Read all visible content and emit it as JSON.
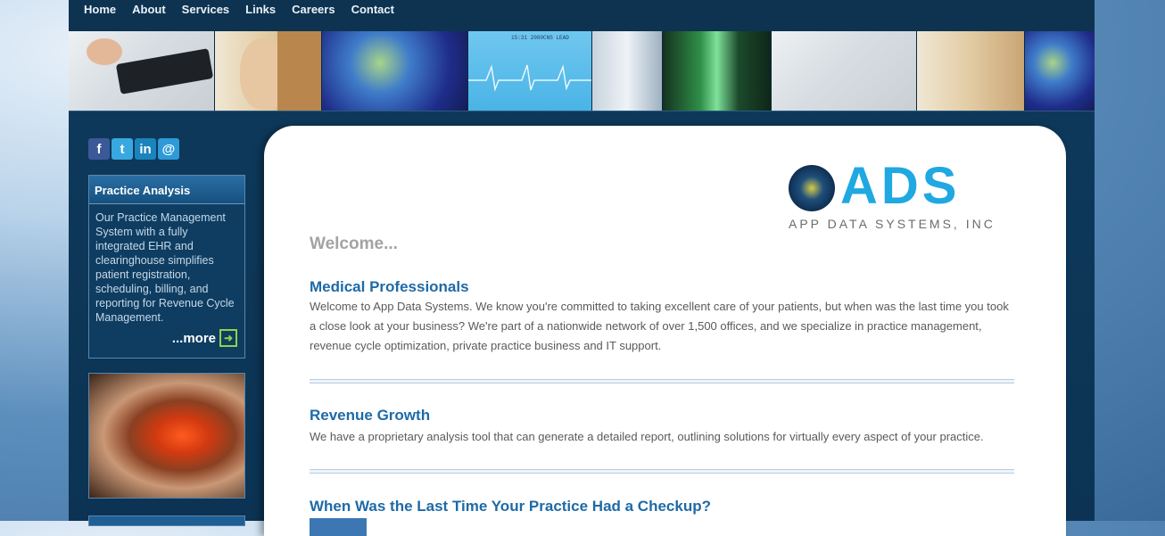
{
  "nav": {
    "items": [
      "Home",
      "About",
      "Services",
      "Links",
      "Careers",
      "Contact"
    ]
  },
  "banner": {
    "ekg_text": "15:31  2000CNS  LEAD"
  },
  "social": {
    "facebook": "f",
    "twitter": "t",
    "linkedin": "in",
    "email": "@"
  },
  "sidebar": {
    "box_title": "Practice Analysis",
    "box_text": "Our Practice Management System with a fully integrated EHR and clearinghouse simplifies patient registration, scheduling, billing, and reporting for Revenue Cycle Management.",
    "more_label": "...more",
    "more_arrow": "➜"
  },
  "logo": {
    "letters": "ADS",
    "subtitle": "APP DATA SYSTEMS, INC"
  },
  "main": {
    "welcome": "Welcome...",
    "sections": [
      {
        "title": "Medical Professionals",
        "text": "Welcome to App Data Systems. We know you're committed to taking excellent care of your patients, but when was the last time you took a close look at your business? We're part of a nationwide network of over 1,500 offices, and we specialize in practice management, revenue cycle optimization, private practice business and IT support."
      },
      {
        "title": "Revenue Growth",
        "text": "We have a proprietary analysis tool that can generate a detailed report, outlining solutions for virtually every aspect of your practice."
      },
      {
        "title": "When Was the Last Time Your Practice Had a Checkup?"
      }
    ]
  },
  "colors": {
    "brand": "#1fa8e2",
    "heading": "#1e6aa7",
    "page_bg": "#0c3353"
  }
}
